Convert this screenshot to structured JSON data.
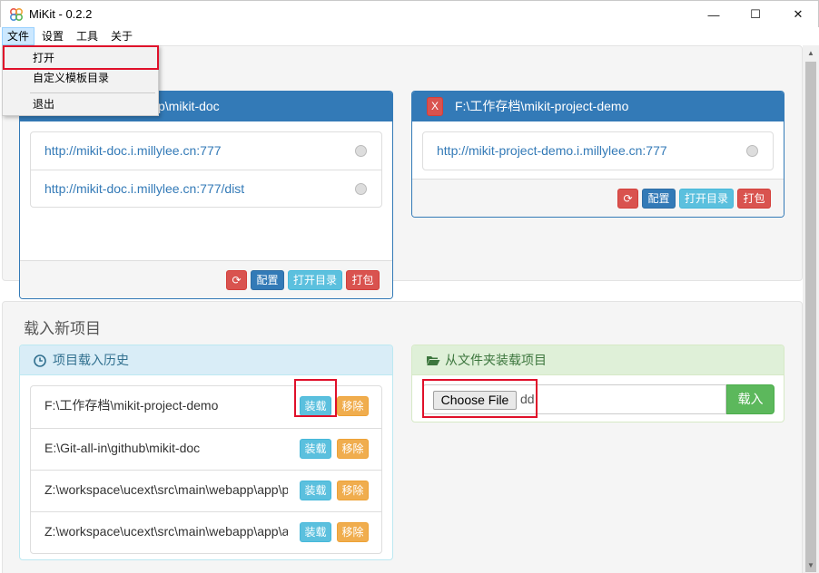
{
  "window": {
    "title": "MiKit - 0.2.2",
    "minimize_glyph": "—",
    "maximize_glyph": "☐",
    "close_glyph": "✕"
  },
  "menu": {
    "items": [
      "文件",
      "设置",
      "工具",
      "关于"
    ],
    "dropdown": [
      "打开",
      "自定义模板目录",
      "退出"
    ]
  },
  "projects": [
    {
      "path_visible": "p\\mikit-doc",
      "urls": [
        "http://mikit-doc.i.millylee.cn:777",
        "http://mikit-doc.i.millylee.cn:777/dist"
      ],
      "buttons": {
        "refresh": "⟳",
        "config": "配置",
        "open_dir": "打开目录",
        "pack": "打包"
      }
    },
    {
      "close": "X",
      "path": "F:\\工作存档\\mikit-project-demo",
      "urls": [
        "http://mikit-project-demo.i.millylee.cn:777"
      ],
      "buttons": {
        "refresh": "⟳",
        "config": "配置",
        "open_dir": "打开目录",
        "pack": "打包"
      }
    }
  ],
  "load": {
    "section_title": "载入新项目",
    "history_title": "项目载入历史",
    "history": [
      "F:\\工作存档\\mikit-project-demo",
      "E:\\Git-all-in\\github\\mikit-doc",
      "Z:\\workspace\\ucext\\src\\main\\webapp\\app\\p",
      "Z:\\workspace\\ucext\\src\\main\\webapp\\app\\a"
    ],
    "load_btn": "装载",
    "remove_btn": "移除",
    "folder_title": "从文件夹装载项目",
    "choose_file": "Choose File",
    "file_value": "dd",
    "submit": "载入"
  },
  "colors": {
    "primary": "#337ab7",
    "danger": "#d9534f",
    "info": "#5bc0de",
    "warning": "#f0ad4e",
    "success": "#5cb85c",
    "highlight": "#e0102a"
  },
  "icons": [
    "app-logo-icon",
    "refresh-icon",
    "clock-icon",
    "folder-open-icon"
  ]
}
